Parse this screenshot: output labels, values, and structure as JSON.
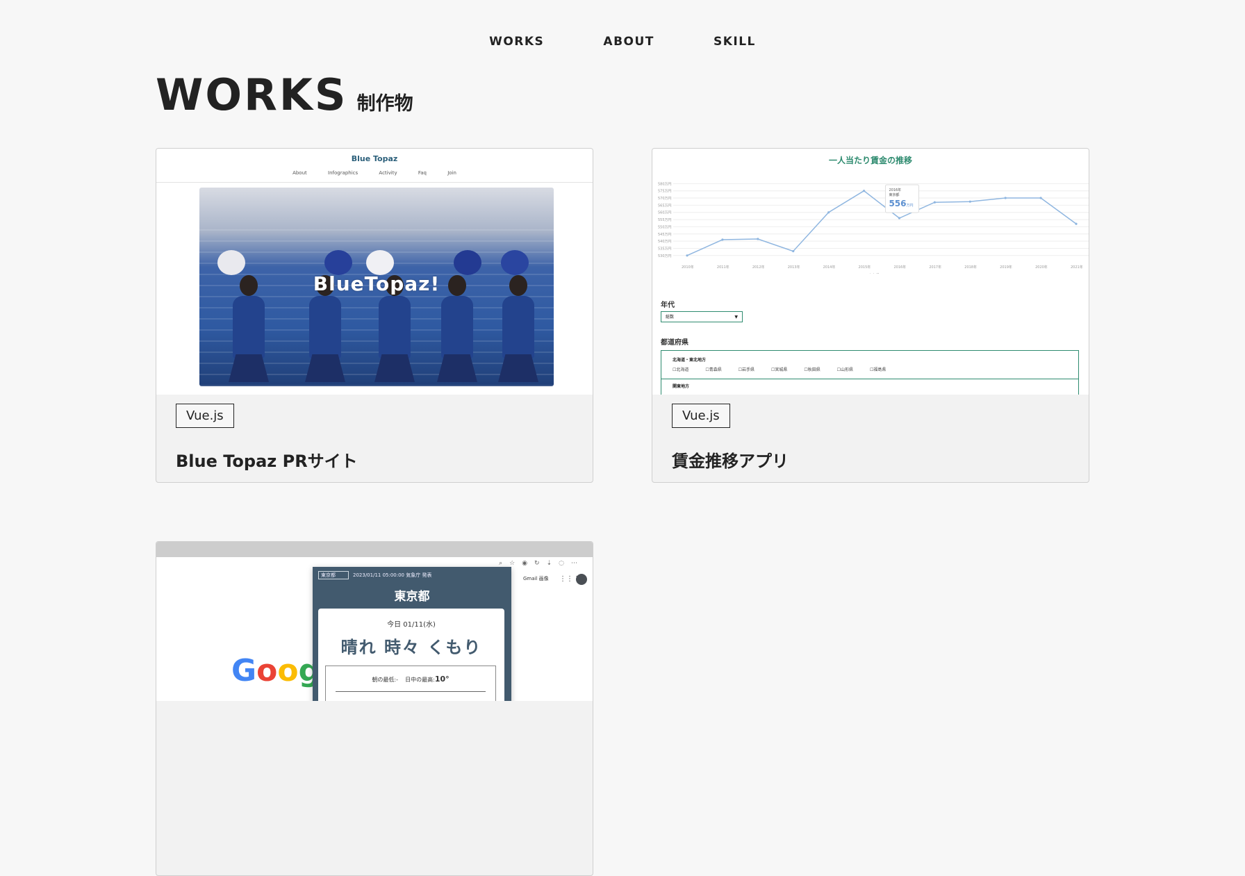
{
  "nav": {
    "works": "WORKS",
    "about": "ABOUT",
    "skill": "SKILL"
  },
  "heading": {
    "en": "WORKS",
    "jp": "制作物"
  },
  "cards": [
    {
      "tag": "Vue.js",
      "title": "Blue Topaz PRサイト",
      "thumb": {
        "logo": "Blue Topaz",
        "menu": [
          "About",
          "Infographics",
          "Activity",
          "Faq",
          "Join"
        ],
        "hero_text": "BlueTopaz!"
      }
    },
    {
      "tag": "Vue.js",
      "title": "賃金推移アプリ",
      "thumb": {
        "chart_title": "一人当たり賃金の推移",
        "tooltip": {
          "year": "2016年",
          "region": "東京都",
          "value": "556",
          "unit": "万円"
        },
        "legend": "東京都",
        "label_age": "年代",
        "select_value": "総数",
        "label_pref": "都道府県",
        "region1": "北海道・東北地方",
        "prefs1": [
          "北海道",
          "青森県",
          "岩手県",
          "宮城県",
          "秋田県",
          "山形県",
          "福島県"
        ],
        "region2": "関東地方"
      }
    },
    {
      "thumb": {
        "google": [
          "G",
          "o",
          "o",
          "g"
        ],
        "gmail": "Gmail 画像",
        "weather_select": "東京都",
        "weather_meta": "2023/01/11 05:00:00 気象庁 発表",
        "city": "東京都",
        "date": "今日 01/11(水)",
        "condition": "晴れ 時々 くもり",
        "temp_min_label": "朝の最低:",
        "temp_min": "-",
        "temp_max_label": "日中の最高:",
        "temp_max": "10°"
      }
    }
  ],
  "chart_data": {
    "type": "line",
    "title": "一人当たり賃金の推移",
    "x": [
      "2010年",
      "2011年",
      "2012年",
      "2013年",
      "2014年",
      "2015年",
      "2016年",
      "2017年",
      "2018年",
      "2019年",
      "2020年",
      "2021年"
    ],
    "series": [
      {
        "name": "東京都",
        "values": [
          530,
          541,
          541.5,
          533,
          560,
          575,
          556,
          567,
          567.5,
          570,
          570,
          552
        ]
      }
    ],
    "yticks": [
      "530万円",
      "535万円",
      "540万円",
      "545万円",
      "550万円",
      "555万円",
      "560万円",
      "565万円",
      "570万円",
      "575万円",
      "580万円"
    ],
    "ylim": [
      527,
      585
    ],
    "colors": {
      "line": "#8fb6e0",
      "accent": "#2e8b6f"
    }
  }
}
